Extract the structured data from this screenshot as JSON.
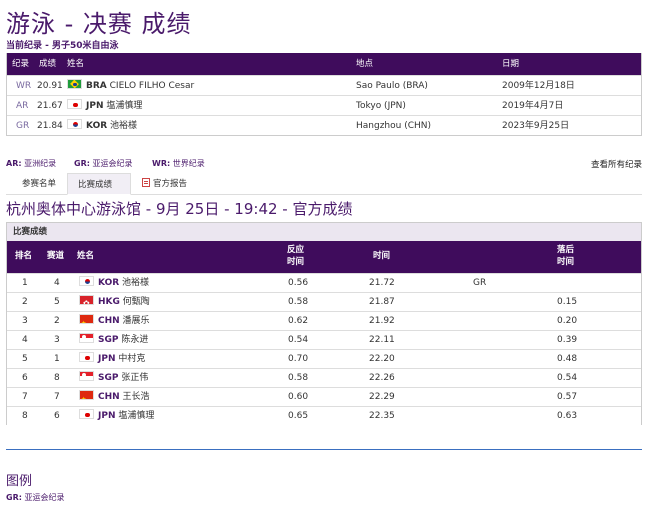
{
  "page": {
    "title": "游泳 - 决赛 成绩",
    "subtitle": "当前纪录 - 男子50米自由泳"
  },
  "records": {
    "headers": {
      "record": "纪录",
      "result": "成绩",
      "name": "姓名",
      "place": "地点",
      "date": "日期"
    },
    "rows": [
      {
        "code": "WR",
        "result": "20.91",
        "flag": "bra",
        "noc": "BRA",
        "name": "CIELO FILHO Cesar",
        "place": "Sao Paulo (BRA)",
        "date": "2009年12月18日"
      },
      {
        "code": "AR",
        "result": "21.67",
        "flag": "jpn",
        "noc": "JPN",
        "name": "塩浦慎理",
        "place": "Tokyo (JPN)",
        "date": "2019年4月7日"
      },
      {
        "code": "GR",
        "result": "21.84",
        "flag": "kor",
        "noc": "KOR",
        "name": "池裕様",
        "place": "Hangzhou (CHN)",
        "date": "2023年9月25日"
      }
    ]
  },
  "legend_bar": {
    "ar_code": "AR:",
    "ar_label": "亚洲纪录",
    "gr_code": "GR:",
    "gr_label": "亚运会纪录",
    "wr_code": "WR:",
    "wr_label": "世界纪录",
    "all_records": "查看所有纪录"
  },
  "tabs": {
    "entry_list": "参赛名单",
    "results": "比赛成绩",
    "report": "官方报告"
  },
  "venue_heading": "杭州奥体中心游泳馆 - 9月 25日 - 19:42 - 官方成绩",
  "results": {
    "caption": "比赛成绩",
    "headers": {
      "rank": "排名",
      "lane": "赛道",
      "name": "姓名",
      "reaction_1": "反应",
      "reaction_2": "时间",
      "time": "时间",
      "behind_1": "落后",
      "behind_2": "时间"
    },
    "rows": [
      {
        "rank": "1",
        "lane": "4",
        "flag": "kor",
        "noc": "KOR",
        "name": "池裕様",
        "reaction": "0.56",
        "time": "21.72",
        "record": "GR",
        "behind": ""
      },
      {
        "rank": "2",
        "lane": "5",
        "flag": "hkg",
        "noc": "HKG",
        "name": "何甄陶",
        "reaction": "0.58",
        "time": "21.87",
        "record": "",
        "behind": "0.15"
      },
      {
        "rank": "3",
        "lane": "2",
        "flag": "chn",
        "noc": "CHN",
        "name": "潘展乐",
        "reaction": "0.62",
        "time": "21.92",
        "record": "",
        "behind": "0.20"
      },
      {
        "rank": "4",
        "lane": "3",
        "flag": "sgp",
        "noc": "SGP",
        "name": "陈永进",
        "reaction": "0.54",
        "time": "22.11",
        "record": "",
        "behind": "0.39"
      },
      {
        "rank": "5",
        "lane": "1",
        "flag": "jpn",
        "noc": "JPN",
        "name": "中村克",
        "reaction": "0.70",
        "time": "22.20",
        "record": "",
        "behind": "0.48"
      },
      {
        "rank": "6",
        "lane": "8",
        "flag": "sgp",
        "noc": "SGP",
        "name": "张正伟",
        "reaction": "0.58",
        "time": "22.26",
        "record": "",
        "behind": "0.54"
      },
      {
        "rank": "7",
        "lane": "7",
        "flag": "chn",
        "noc": "CHN",
        "name": "王长浩",
        "reaction": "0.60",
        "time": "22.29",
        "record": "",
        "behind": "0.57"
      },
      {
        "rank": "8",
        "lane": "6",
        "flag": "jpn",
        "noc": "JPN",
        "name": "塩浦慎理",
        "reaction": "0.65",
        "time": "22.35",
        "record": "",
        "behind": "0.63"
      }
    ]
  },
  "legend": {
    "title": "图例",
    "gr_code": "GR:",
    "gr_label": "亚运会纪录"
  },
  "colors": {
    "brand_purple": "#3f0c5c",
    "accent_text": "#4a1a6b"
  }
}
